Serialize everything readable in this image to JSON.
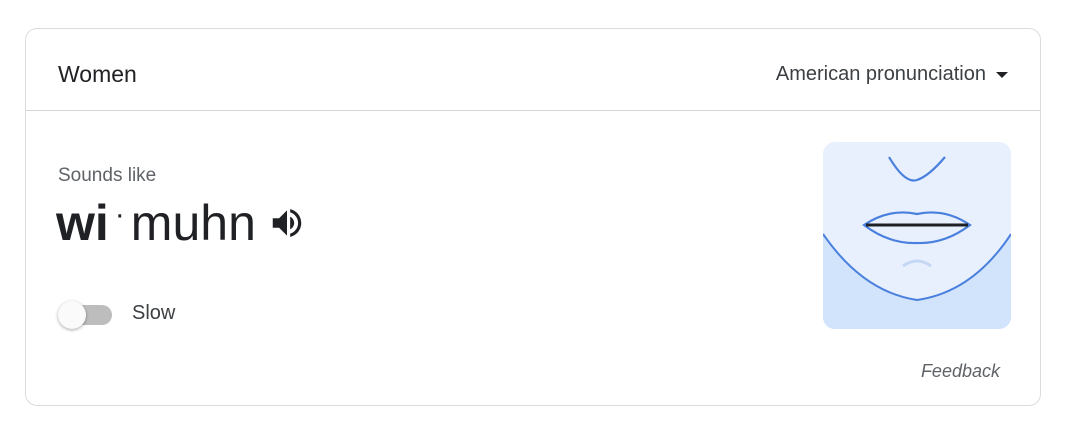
{
  "header": {
    "word": "Women",
    "accent_selector": {
      "selected": "American pronunciation",
      "icon": "caret-down-icon"
    }
  },
  "pronunciation": {
    "sounds_like_label": "Sounds like",
    "syllables": [
      {
        "text": "wi",
        "stressed": true
      },
      {
        "text": "muhn",
        "stressed": false
      }
    ],
    "separator": "·",
    "play_icon": "speaker-icon"
  },
  "slow_toggle": {
    "label": "Slow",
    "on": false
  },
  "illustration": {
    "name": "mouth-illustration",
    "colors": {
      "background": "#e8f0fe",
      "lower_face": "#d2e3fc",
      "outline": "#4a80dd",
      "lip_line": "#202124"
    }
  },
  "feedback_label": "Feedback"
}
